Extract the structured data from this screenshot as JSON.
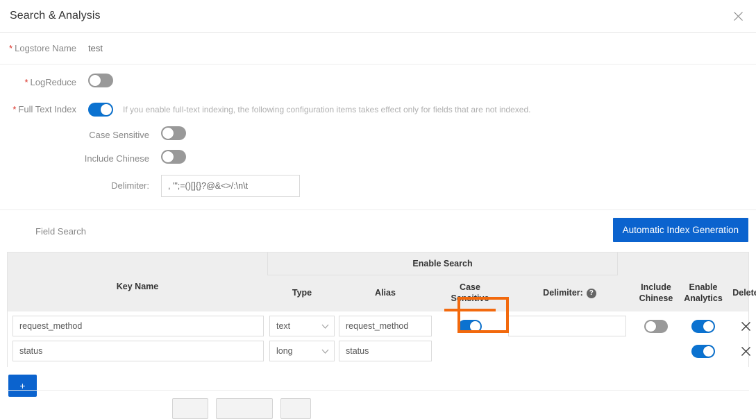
{
  "dialog": {
    "title": "Search & Analysis",
    "close_icon": "close-icon"
  },
  "form": {
    "logstore": {
      "label": "Logstore Name",
      "required": true,
      "value": "test"
    },
    "logreduce": {
      "label": "LogReduce",
      "required": true,
      "enabled": false
    },
    "fulltext": {
      "label": "Full Text Index",
      "required": true,
      "enabled": true,
      "hint": "If you enable full-text indexing, the following configuration items takes effect only for fields that are not indexed."
    },
    "case_sensitive": {
      "label": "Case Sensitive",
      "enabled": false
    },
    "include_chinese": {
      "label": "Include Chinese",
      "enabled": false
    },
    "delimiter": {
      "label": "Delimiter:",
      "value": ", '\";=()[]{}?@&<>/:\\n\\t"
    }
  },
  "field_search": {
    "label": "Field Search",
    "auto_index_button": "Automatic Index Generation"
  },
  "table": {
    "group_header": "Enable Search",
    "columns": {
      "key_name": "Key Name",
      "type": "Type",
      "alias": "Alias",
      "case_sensitive": "Case\nSensitive",
      "case_sensitive_line1": "Case",
      "case_sensitive_line2": "Sensitive",
      "delimiter": "Delimiter:",
      "delimiter_help_icon": "question-mark-icon",
      "include_chinese_line1": "Include",
      "include_chinese_line2": "Chinese",
      "enable_analytics_line1": "Enable",
      "enable_analytics_line2": "Analytics",
      "delete": "Delete"
    },
    "rows": [
      {
        "key_name": "request_method",
        "type": "text",
        "alias": "request_method",
        "case_sensitive": true,
        "delimiter": "",
        "has_delimiter_input": true,
        "include_chinese": false,
        "has_include_chinese": true,
        "enable_analytics": true,
        "delete_icon": "close-icon"
      },
      {
        "key_name": "status",
        "type": "long",
        "alias": "status",
        "case_sensitive": null,
        "delimiter": null,
        "has_delimiter_input": false,
        "include_chinese": null,
        "has_include_chinese": false,
        "enable_analytics": true,
        "delete_icon": "close-icon"
      }
    ]
  },
  "add_button": {
    "label": "+"
  },
  "highlight": {
    "color": "#f2690d",
    "target": "row-1-case-sensitive-toggle"
  },
  "colors": {
    "primary": "#0b63ce",
    "toggle_on": "#0b72d0",
    "toggle_off": "#999999",
    "required_star": "#d93026",
    "highlight": "#f2690d"
  }
}
